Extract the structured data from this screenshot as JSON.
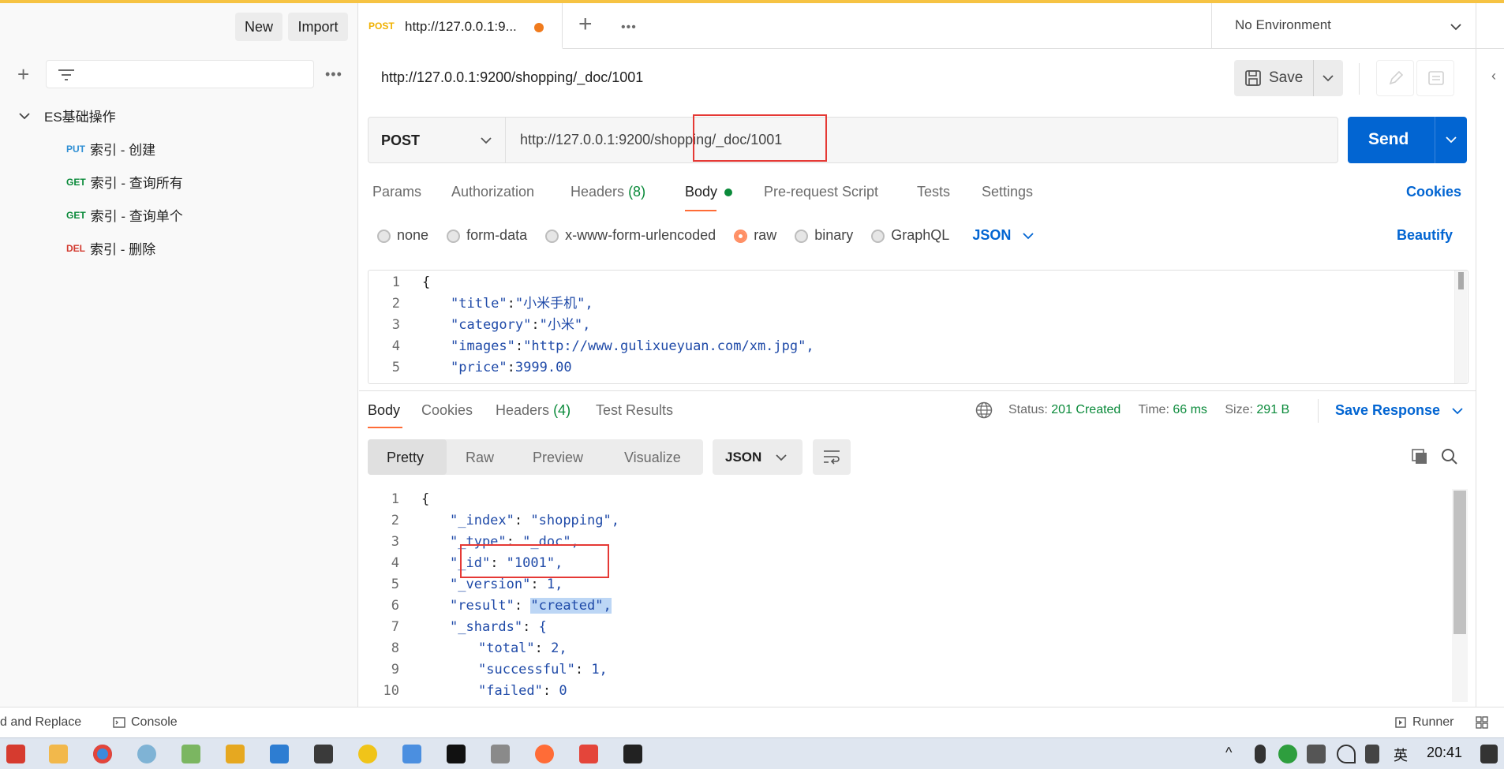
{
  "sidebar": {
    "new_label": "New",
    "import_label": "Import",
    "collection_name": "ES基础操作",
    "items": [
      {
        "method": "PUT",
        "name": "索引 - 创建",
        "color": "#2f8fd4"
      },
      {
        "method": "GET",
        "name": "索引 - 查询所有",
        "color": "#0a8a3a"
      },
      {
        "method": "GET",
        "name": "索引 - 查询单个",
        "color": "#0a8a3a"
      },
      {
        "method": "DEL",
        "name": "索引 - 删除",
        "color": "#d23a2f"
      }
    ]
  },
  "tab": {
    "method": "POST",
    "url": "http://127.0.0.1:9...",
    "environment": "No Environment"
  },
  "request": {
    "title": "http://127.0.0.1:9200/shopping/_doc/1001",
    "save_label": "Save",
    "method": "POST",
    "url": "http://127.0.0.1:9200/shopping/_doc/1001",
    "send_label": "Send",
    "tabs": [
      "Params",
      "Authorization",
      "Headers",
      "(8)",
      "Body",
      "Pre-request Script",
      "Tests",
      "Settings"
    ],
    "cookies_label": "Cookies",
    "body_types": [
      "none",
      "form-data",
      "x-www-form-urlencoded",
      "raw",
      "binary",
      "GraphQL"
    ],
    "format": "JSON",
    "beautify_label": "Beautify",
    "body_lines": [
      {
        "n": "1",
        "text": "{"
      },
      {
        "n": "2",
        "k": "\"title\"",
        "v": "\"小米手机\","
      },
      {
        "n": "3",
        "k": "\"category\"",
        "v": "\"小米\","
      },
      {
        "n": "4",
        "k": "\"images\"",
        "v": "\"http://www.gulixueyuan.com/xm.jpg\","
      },
      {
        "n": "5",
        "k": "\"price\"",
        "v": "3999.00"
      }
    ]
  },
  "response": {
    "tabs": [
      "Body",
      "Cookies",
      "Headers",
      "(4)",
      "Test Results"
    ],
    "status_label": "Status:",
    "status_value": "201 Created",
    "time_label": "Time:",
    "time_value": "66 ms",
    "size_label": "Size:",
    "size_value": "291 B",
    "save_response_label": "Save Response",
    "view_modes": [
      "Pretty",
      "Raw",
      "Preview",
      "Visualize"
    ],
    "format": "JSON",
    "lines": [
      {
        "n": "1",
        "text": "{"
      },
      {
        "n": "2",
        "k": "\"_index\"",
        "v": "\"shopping\","
      },
      {
        "n": "3",
        "k": "\"_type\"",
        "v": "\"_doc\","
      },
      {
        "n": "4",
        "k": "\"_id\"",
        "v": "\"1001\","
      },
      {
        "n": "5",
        "k": "\"_version\"",
        "v": "1,"
      },
      {
        "n": "6",
        "k": "\"result\"",
        "v": "\"created\","
      },
      {
        "n": "7",
        "k": "\"_shards\"",
        "v": "{"
      },
      {
        "n": "8",
        "k": "\"total\"",
        "v": "2,"
      },
      {
        "n": "9",
        "k": "\"successful\"",
        "v": "1,"
      },
      {
        "n": "10",
        "k": "\"failed\"",
        "v": "0"
      }
    ]
  },
  "statusbar": {
    "find_replace": "d and Replace",
    "console": "Console",
    "runner": "Runner"
  },
  "taskbar": {
    "ime": "英",
    "clock": "20:41"
  }
}
